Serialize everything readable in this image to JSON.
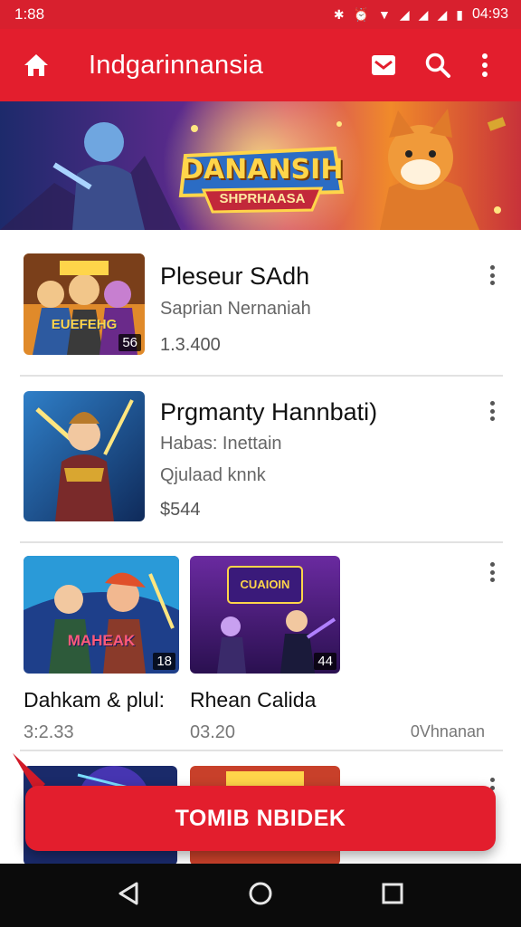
{
  "status_bar": {
    "time": "1:88",
    "clock": "04:93"
  },
  "app_bar": {
    "title": "Indgarinnansia",
    "icons": [
      "home-icon",
      "mail-icon",
      "search-icon",
      "more-vert-icon"
    ]
  },
  "banner": {
    "title": "DANANSIH",
    "subtitle": "SHPRHAASA"
  },
  "items": [
    {
      "title": "Pleseur SAdh",
      "subtitle": "Saprian Nernaniah",
      "meta": "1.3.400",
      "badge": "56",
      "thumb_text": "EUEFEHG"
    },
    {
      "title": "Prgmanty Hannbati)",
      "subtitle": "Habas: Inettain",
      "subtitle2": "Qjulaad knnk",
      "meta": "$544"
    }
  ],
  "grid": [
    {
      "title": "Dahkam & plul:",
      "meta": "3:2.33",
      "badge": "18",
      "thumb_text": "MAHEAK"
    },
    {
      "title": "Rhean Calida",
      "meta": "03.20",
      "badge": "44",
      "thumb_text": "CUAIOIN",
      "extra": "0Vhnanan"
    }
  ],
  "cta": {
    "label": "TOMIB NBIDEK"
  },
  "colors": {
    "primary": "#e31e2d",
    "status": "#d8202e",
    "nav": "#0b0b0b"
  }
}
